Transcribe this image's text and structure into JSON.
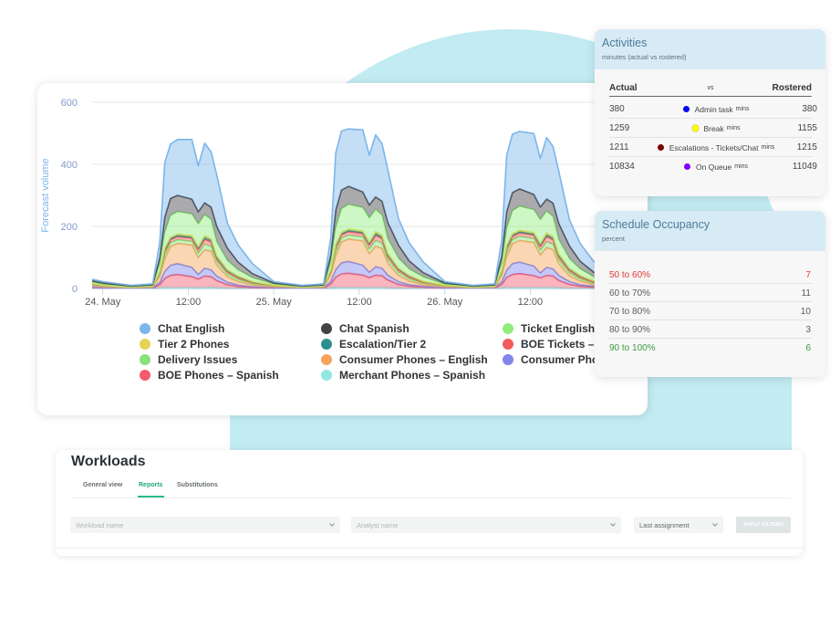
{
  "chart_data": {
    "type": "area",
    "stacking": "normal",
    "title": "",
    "xlabel": "",
    "ylabel": "Forecast volume",
    "ylim": [
      0,
      600
    ],
    "yticks": [
      0,
      200,
      400,
      600
    ],
    "xunit": "hours from 24. May 00:00",
    "xlim": [
      -1.5,
      73.9
    ],
    "xticks": [
      {
        "x": 0,
        "label": "24. May"
      },
      {
        "x": 12,
        "label": "12:00"
      },
      {
        "x": 24,
        "label": "25. May"
      },
      {
        "x": 36,
        "label": "12:00"
      },
      {
        "x": 48,
        "label": "26. May"
      },
      {
        "x": 60,
        "label": "12:00"
      }
    ],
    "grid": true,
    "legend_position": "bottom",
    "x": [
      -1.5,
      0,
      4,
      7,
      8,
      8.7,
      9.5,
      10.5,
      12.5,
      13.4,
      14.3,
      15.2,
      16,
      17.5,
      19,
      21,
      24,
      28,
      31,
      32,
      32.7,
      33.5,
      34.5,
      36.5,
      37.4,
      38.3,
      39.2,
      40,
      41.5,
      43,
      45,
      48,
      52,
      55,
      56,
      56.7,
      57.5,
      58.5,
      60.5,
      61.4,
      62.3,
      63.2,
      64,
      65.5,
      67,
      69
    ],
    "series": [
      {
        "name": "Chat English",
        "color": "#7cb5ec",
        "values": [
          5,
          4,
          2,
          3,
          50,
          175,
          175,
          180,
          192,
          148,
          192,
          178,
          165,
          80,
          55,
          32,
          4,
          2,
          3,
          55,
          185,
          190,
          185,
          200,
          160,
          200,
          185,
          170,
          85,
          58,
          34,
          4,
          2,
          3,
          53,
          182,
          188,
          185,
          196,
          156,
          198,
          182,
          168,
          84,
          57,
          33
        ]
      },
      {
        "name": "Chat Spanish",
        "color": "#434348",
        "values": [
          4,
          4,
          2,
          2,
          20,
          50,
          55,
          52,
          48,
          39,
          38,
          40,
          50,
          40,
          25,
          13,
          4,
          2,
          2,
          22,
          55,
          60,
          58,
          50,
          42,
          40,
          44,
          52,
          42,
          26,
          14,
          4,
          2,
          2,
          21,
          54,
          58,
          56,
          49,
          41,
          39,
          43,
          51,
          41,
          25,
          14
        ]
      },
      {
        "name": "Ticket English",
        "color": "#90ed7d",
        "values": [
          5,
          4,
          2,
          3,
          25,
          50,
          70,
          73,
          70,
          73,
          68,
          62,
          45,
          30,
          20,
          13,
          4,
          2,
          3,
          27,
          55,
          76,
          80,
          76,
          78,
          72,
          66,
          48,
          32,
          21,
          14,
          4,
          2,
          3,
          26,
          54,
          75,
          78,
          74,
          77,
          70,
          65,
          47,
          31,
          21,
          14
        ]
      },
      {
        "name": "Tier 2 Phones",
        "color": "#e4d354",
        "values": [
          1,
          0,
          0,
          0,
          2,
          4,
          4,
          4,
          4,
          4,
          6,
          5,
          4,
          3,
          2,
          1,
          0,
          0,
          0,
          2,
          4,
          4,
          4,
          4,
          4,
          6,
          5,
          4,
          3,
          2,
          1,
          0,
          0,
          0,
          2,
          4,
          4,
          4,
          4,
          4,
          6,
          5,
          4,
          3,
          2,
          1
        ]
      },
      {
        "name": "Escalation/Tier 2",
        "color": "#2b908f",
        "values": [
          1,
          1,
          0,
          1,
          2,
          5,
          4,
          4,
          4,
          5,
          6,
          5,
          4,
          3,
          3,
          2,
          1,
          0,
          1,
          2,
          5,
          4,
          4,
          4,
          5,
          6,
          5,
          4,
          3,
          3,
          2,
          1,
          0,
          1,
          2,
          5,
          4,
          4,
          4,
          5,
          6,
          5,
          4,
          3,
          3,
          2
        ]
      },
      {
        "name": "BOE Tickets – I",
        "color": "#f45b5b",
        "values": [
          2,
          1,
          0,
          1,
          5,
          12,
          10,
          10,
          10,
          12,
          15,
          14,
          10,
          7,
          6,
          3,
          1,
          0,
          1,
          5,
          13,
          11,
          11,
          11,
          13,
          16,
          15,
          11,
          8,
          6,
          3,
          1,
          0,
          1,
          5,
          13,
          11,
          11,
          11,
          13,
          16,
          15,
          11,
          8,
          6,
          3
        ]
      },
      {
        "name": "Delivery Issues",
        "color": "#88e27a",
        "values": [
          3,
          2,
          1,
          1,
          6,
          14,
          12,
          12,
          12,
          14,
          18,
          16,
          12,
          9,
          7,
          4,
          2,
          1,
          1,
          6,
          15,
          13,
          13,
          13,
          15,
          19,
          17,
          13,
          10,
          7,
          4,
          2,
          1,
          1,
          6,
          15,
          13,
          13,
          13,
          15,
          19,
          17,
          13,
          10,
          7,
          4
        ]
      },
      {
        "name": "Consumer Phones – English",
        "color": "#f7a35c",
        "values": [
          4,
          3,
          2,
          2,
          20,
          40,
          60,
          65,
          72,
          55,
          60,
          60,
          35,
          18,
          11,
          6,
          3,
          2,
          2,
          22,
          45,
          66,
          72,
          78,
          60,
          66,
          64,
          38,
          20,
          12,
          6,
          3,
          2,
          2,
          21,
          44,
          64,
          70,
          76,
          58,
          64,
          62,
          37,
          19,
          12,
          6
        ]
      },
      {
        "name": "Consumer Pho",
        "color": "#8085e9",
        "values": [
          2,
          1,
          0,
          1,
          8,
          23,
          33,
          35,
          30,
          15,
          25,
          22,
          15,
          8,
          5,
          3,
          1,
          0,
          1,
          9,
          25,
          36,
          38,
          32,
          17,
          27,
          24,
          16,
          9,
          5,
          3,
          1,
          0,
          1,
          9,
          24,
          35,
          37,
          31,
          16,
          26,
          23,
          16,
          9,
          5,
          3
        ]
      },
      {
        "name": "BOE Phones – Spanish",
        "color": "#f45b6e",
        "values": [
          2,
          1,
          1,
          1,
          10,
          29,
          39,
          42,
          35,
          28,
          37,
          35,
          23,
          11,
          5,
          2,
          1,
          1,
          1,
          12,
          33,
          44,
          46,
          40,
          32,
          40,
          38,
          25,
          12,
          6,
          3,
          1,
          1,
          1,
          11,
          32,
          42,
          45,
          38,
          31,
          39,
          37,
          24,
          12,
          6,
          3
        ]
      },
      {
        "name": "Merchant Phones – Spanish",
        "color": "#91e8e1",
        "values": [
          1,
          1,
          0,
          0,
          2,
          3,
          3,
          3,
          3,
          2,
          3,
          3,
          2,
          1,
          1,
          1,
          1,
          0,
          0,
          2,
          3,
          3,
          3,
          3,
          3,
          3,
          3,
          2,
          1,
          1,
          1,
          1,
          0,
          0,
          2,
          3,
          3,
          3,
          3,
          3,
          3,
          3,
          2,
          1,
          1,
          1
        ]
      }
    ]
  },
  "activities": {
    "title": "Activities",
    "subtitle": "minutes (actual vs rostered)",
    "col_actual": "Actual",
    "col_vs": "vs",
    "col_rostered": "Rostered",
    "rows": [
      {
        "actual": "380",
        "label": "Admin task",
        "unit": "mins",
        "rostered": "380",
        "dot_color": "#0000ff"
      },
      {
        "actual": "1259",
        "label": "Break",
        "unit": "mins",
        "rostered": "1155",
        "dot_color": "#ffff00"
      },
      {
        "actual": "1211",
        "label": "Escalations - Tickets/Chat",
        "unit": "mins",
        "rostered": "1215",
        "dot_color": "#7a0000"
      },
      {
        "actual": "10834",
        "label": "On Queue",
        "unit": "mins",
        "rostered": "11049",
        "dot_color": "#8000ff"
      }
    ]
  },
  "occupancy": {
    "title": "Schedule Occupancy",
    "subtitle": "percent",
    "rows": [
      {
        "range": "50 to 60%",
        "count": "7",
        "color": "#e53935"
      },
      {
        "range": "60 to 70%",
        "count": "11",
        "color": "#5b5b5b"
      },
      {
        "range": "70 to 80%",
        "count": "10",
        "color": "#5b5b5b"
      },
      {
        "range": "80 to 90%",
        "count": "3",
        "color": "#5b5b5b"
      },
      {
        "range": "90 to 100%",
        "count": "6",
        "color": "#3f9b3f"
      }
    ]
  },
  "workloads": {
    "title": "Workloads",
    "tabs": [
      {
        "label": "General view",
        "active": false
      },
      {
        "label": "Reports",
        "active": true
      },
      {
        "label": "Substitutions",
        "active": false
      }
    ],
    "filters": {
      "workload_placeholder": "Workload name",
      "analyst_placeholder": "Analyst name",
      "assignment_value": "Last assignment",
      "apply_label": "APPLY FILTERS"
    },
    "accent_color": "#2bb98a"
  },
  "icons": {
    "select_chevron": "chevron-down-icon",
    "legend_marker": "circle-icon",
    "activity_dot": "circle-icon"
  }
}
